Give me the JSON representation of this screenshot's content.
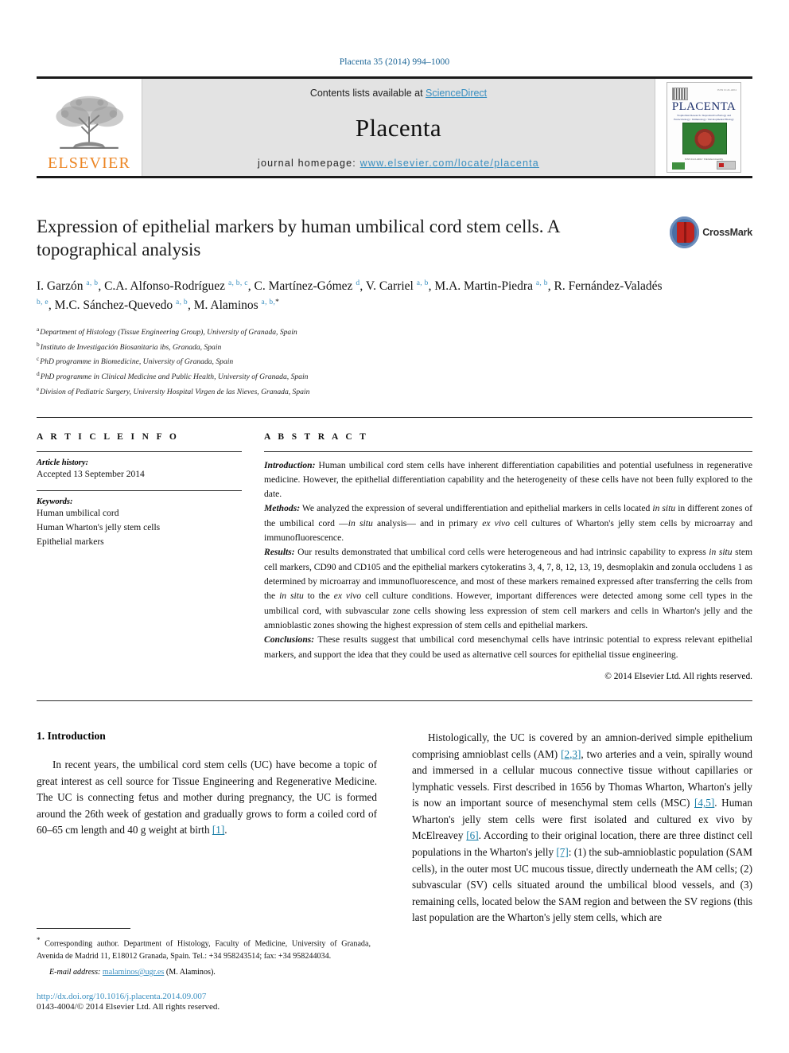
{
  "running_head": "Placenta 35 (2014) 994–1000",
  "masthead": {
    "publisher_logo_text": "ELSEVIER",
    "contents_prefix": "Contents lists available at ",
    "contents_link": "ScienceDirect",
    "journal_name": "Placenta",
    "homepage_prefix": "journal homepage: ",
    "homepage_url": "www.elsevier.com/locate/placenta",
    "cover": {
      "title": "PLACENTA",
      "subtitle": "AN INTERNATIONAL JOURNAL",
      "issn_line": "ISSN 0143-4004",
      "tagline": "Trophoblast Research / Reproductive Biology and Endocrinology / Immunology / Developmental Biology",
      "footer": "ISSN 0143-4004  •  Published monthly"
    }
  },
  "crossmark": {
    "label": "CrossMark"
  },
  "article": {
    "title": "Expression of epithelial markers by human umbilical cord stem cells. A topographical analysis",
    "authors": [
      {
        "name": "I. Garzón",
        "marks": "a, b",
        "sep": ", "
      },
      {
        "name": "C.A. Alfonso-Rodríguez",
        "marks": "a, b, c",
        "sep": ", "
      },
      {
        "name": "C. Martínez-Gómez",
        "marks": "d",
        "sep": ", "
      },
      {
        "name": "V. Carriel",
        "marks": "a, b",
        "sep": ", "
      },
      {
        "name": "M.A. Martin-Piedra",
        "marks": "a, b",
        "sep": ", "
      },
      {
        "name": "R. Fernández-Valadés",
        "marks": "b, e",
        "sep": ", "
      },
      {
        "name": "M.C. Sánchez-Quevedo",
        "marks": "a, b",
        "sep": ", "
      },
      {
        "name": "M. Alaminos",
        "marks": "a, b,",
        "star": "*",
        "sep": ""
      }
    ],
    "affiliations": [
      {
        "mark": "a",
        "text": "Department of Histology (Tissue Engineering Group), University of Granada, Spain"
      },
      {
        "mark": "b",
        "text": "Instituto de Investigación Biosanitaria ibs, Granada, Spain"
      },
      {
        "mark": "c",
        "text": "PhD programme in Biomedicine, University of Granada, Spain"
      },
      {
        "mark": "d",
        "text": "PhD programme in Clinical Medicine and Public Health, University of Granada, Spain"
      },
      {
        "mark": "e",
        "text": "Division of Pediatric Surgery, University Hospital Virgen de las Nieves, Granada, Spain"
      }
    ]
  },
  "article_info": {
    "heading": "A R T I C L E   I N F O",
    "history_label": "Article history:",
    "history_value": "Accepted 13 September 2014",
    "keywords_label": "Keywords:",
    "keywords": [
      "Human umbilical cord",
      "Human Wharton's jelly stem cells",
      "Epithelial markers"
    ]
  },
  "abstract": {
    "heading": "A B S T R A C T",
    "introduction_label": "Introduction:",
    "introduction_text": " Human umbilical cord stem cells have inherent differentiation capabilities and potential usefulness in regenerative medicine. However, the epithelial differentiation capability and the heterogeneity of these cells have not been fully explored to the date.",
    "methods_label": "Methods:",
    "methods_text_1": " We analyzed the expression of several undifferentiation and epithelial markers in cells located ",
    "methods_italic_1": "in situ",
    "methods_text_2": " in different zones of the umbilical cord —",
    "methods_italic_2": "in situ",
    "methods_text_3": " analysis— and in primary ",
    "methods_italic_3": "ex vivo",
    "methods_text_4": " cell cultures of Wharton's jelly stem cells by microarray and immunofluorescence.",
    "results_label": "Results:",
    "results_text_1": " Our results demonstrated that umbilical cord cells were heterogeneous and had intrinsic capability to express ",
    "results_italic_1": "in situ",
    "results_text_2": " stem cell markers, CD90 and CD105 and the epithelial markers cytokeratins 3, 4, 7, 8, 12, 13, 19, desmoplakin and zonula occludens 1 as determined by microarray and immunofluorescence, and most of these markers remained expressed after transferring the cells from the ",
    "results_italic_2": "in situ",
    "results_text_3": " to the ",
    "results_italic_3": "ex vivo",
    "results_text_4": " cell culture conditions. However, important differences were detected among some cell types in the umbilical cord, with subvascular zone cells showing less expression of stem cell markers and cells in Wharton's jelly and the amnioblastic zones showing the highest expression of stem cells and epithelial markers.",
    "conclusions_label": "Conclusions:",
    "conclusions_text": " These results suggest that umbilical cord mesenchymal cells have intrinsic potential to express relevant epithelial markers, and support the idea that they could be used as alternative cell sources for epithelial tissue engineering.",
    "copyright": "© 2014 Elsevier Ltd. All rights reserved."
  },
  "body": {
    "section_heading": "1. Introduction",
    "left_paragraph_1": "In recent years, the umbilical cord stem cells (UC) have become a topic of great interest as cell source for Tissue Engineering and Regenerative Medicine. The UC is connecting fetus and mother during pregnancy, the UC is formed around the 26th week of gestation and gradually grows to form a coiled cord of 60–65 cm length and 40 g weight at birth ",
    "left_paragraph_1_ref": "[1]",
    "left_paragraph_1_end": ".",
    "right_p1_a": "Histologically, the UC is covered by an amnion-derived simple epithelium comprising amnioblast cells (AM) ",
    "right_p1_ref1": "[2,3]",
    "right_p1_b": ", two arteries and a vein, spirally wound and immersed in a cellular mucous connective tissue without capillaries or lymphatic vessels. First described in 1656 by Thomas Wharton, Wharton's jelly is now an important source of mesenchymal stem cells (MSC) ",
    "right_p1_ref2": "[4,5]",
    "right_p1_c": ". Human Wharton's jelly stem cells were first isolated and cultured ex vivo by McElreavey ",
    "right_p1_ref3": "[6]",
    "right_p1_d": ". According to their original location, there are three distinct cell populations in the Wharton's jelly ",
    "right_p1_ref4": "[7]",
    "right_p1_e": ": (1) the sub-amnioblastic population (SAM cells), in the outer most UC mucous tissue, directly underneath the AM cells; (2) subvascular (SV) cells situated around the umbilical blood vessels, and (3) remaining cells, located below the SAM region and between the SV regions (this last population are the Wharton's jelly stem cells, which are"
  },
  "footnotes": {
    "corresponding_star": "*",
    "corresponding_text": " Corresponding author. Department of Histology, Faculty of Medicine, University of Granada, Avenida de Madrid 11, E18012 Granada, Spain. Tel.: +34 958243514; fax: +34 958244034.",
    "email_label": "E-mail address:",
    "email_value": "malaminos@ugr.es",
    "email_suffix": " (M. Alaminos).",
    "doi": "http://dx.doi.org/10.1016/j.placenta.2014.09.007",
    "issn_line": "0143-4004/© 2014 Elsevier Ltd. All rights reserved."
  },
  "colors": {
    "link": "#3a8fc0",
    "reference": "#1a7fa8",
    "elsevier_orange": "#ec8523",
    "masthead_bg": "#e3e3e3"
  }
}
